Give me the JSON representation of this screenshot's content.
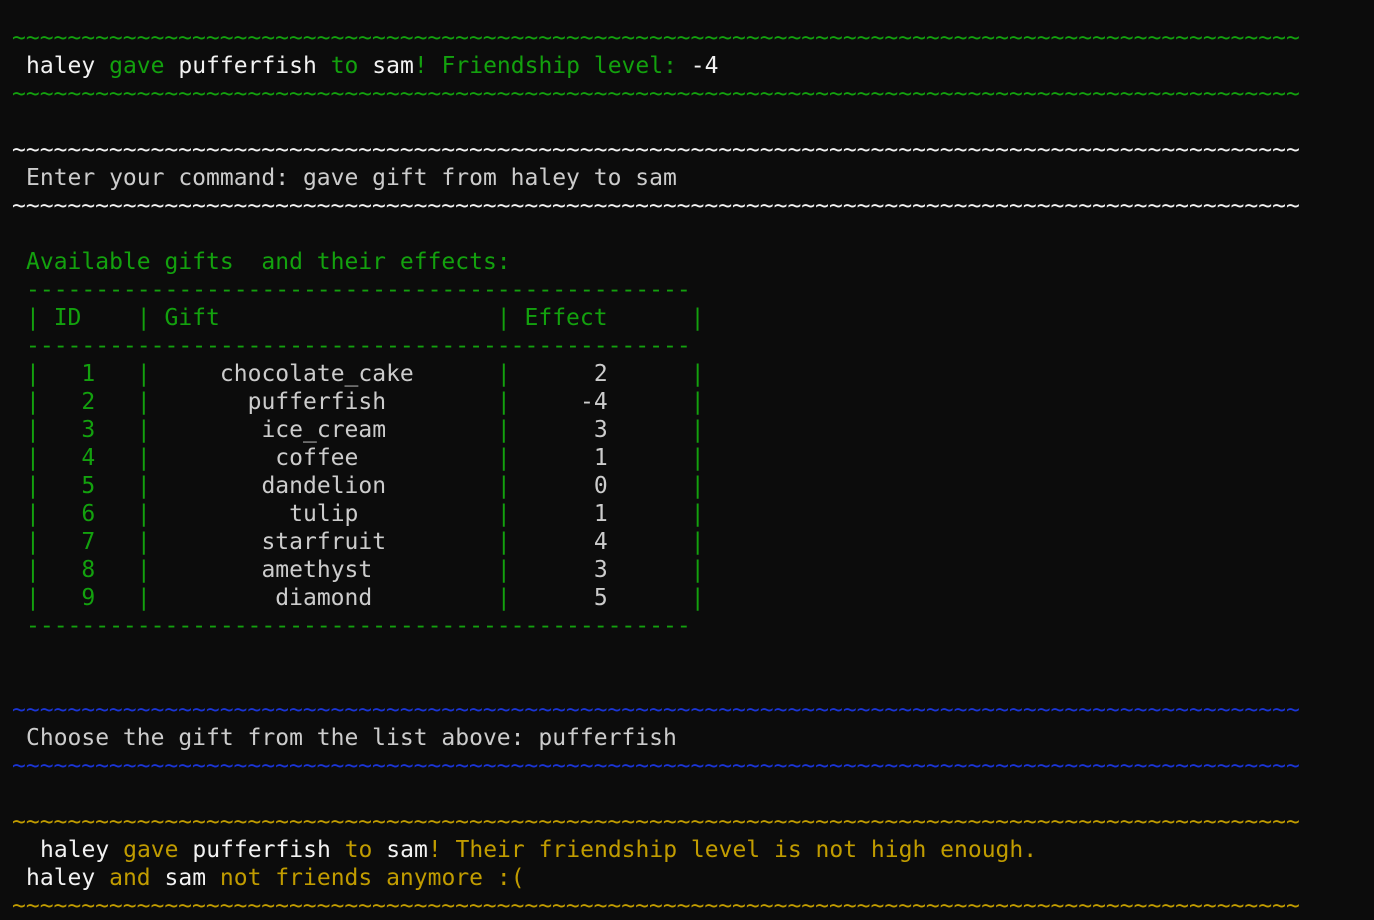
{
  "colors": {
    "background": "#0c0c0c",
    "green": "#13a10e",
    "blue": "#1a35d6",
    "yellow": "#c19c00",
    "white": "#f2f2f2",
    "gray": "#cccccc"
  },
  "block1": {
    "separator": "~~~~~~~~~~~~~~~~~~~~~~~~~~~~~~~~~~~~~~~~~~~~~~~~~~~~~~~~~~~~~~~~~~~~~~~~~~~~~~~~~~~~~~~~~~~~~",
    "giver": "haley",
    "verb": "gave",
    "item": "pufferfish",
    "to": "to",
    "receiver": "sam",
    "bang": "!",
    "level_label": "Friendship level:",
    "level_value": "-4"
  },
  "block2": {
    "separator": "~~~~~~~~~~~~~~~~~~~~~~~~~~~~~~~~~~~~~~~~~~~~~~~~~~~~~~~~~~~~~~~~~~~~~~~~~~~~~~~~~~~~~~~~~~~~~",
    "prompt": "Enter your command: gave gift from haley to sam"
  },
  "gifts_table": {
    "title": "Available gifts  and their effects:",
    "rule": "------------------------------------------------",
    "header": "| ID    | Gift                    | Effect      |",
    "rows": [
      {
        "id": "1",
        "gift": "chocolate_cake",
        "effect": "2"
      },
      {
        "id": "2",
        "gift": "pufferfish",
        "effect": "-4"
      },
      {
        "id": "3",
        "gift": "ice_cream",
        "effect": "3"
      },
      {
        "id": "4",
        "gift": "coffee",
        "effect": "1"
      },
      {
        "id": "5",
        "gift": "dandelion",
        "effect": "0"
      },
      {
        "id": "6",
        "gift": "tulip",
        "effect": "1"
      },
      {
        "id": "7",
        "gift": "starfruit",
        "effect": "4"
      },
      {
        "id": "8",
        "gift": "amethyst",
        "effect": "3"
      },
      {
        "id": "9",
        "gift": "diamond",
        "effect": "5"
      }
    ]
  },
  "block3": {
    "separator": "~~~~~~~~~~~~~~~~~~~~~~~~~~~~~~~~~~~~~~~~~~~~~~~~~~~~~~~~~~~~~~~~~~~~~~~~~~~~~~~~~~~~~~~~~~~~~",
    "prompt": "Choose the gift from the list above: pufferfish"
  },
  "block4": {
    "separator": "~~~~~~~~~~~~~~~~~~~~~~~~~~~~~~~~~~~~~~~~~~~~~~~~~~~~~~~~~~~~~~~~~~~~~~~~~~~~~~~~~~~~~~~~~~~~~",
    "giver": "haley",
    "verb": "gave",
    "item": "pufferfish",
    "to": "to",
    "receiver": "sam",
    "message": "! Their friendship level is not high enough.",
    "line2_giver": "haley",
    "line2_and": "and",
    "line2_receiver": "sam",
    "line2_message": "not friends anymore :("
  }
}
